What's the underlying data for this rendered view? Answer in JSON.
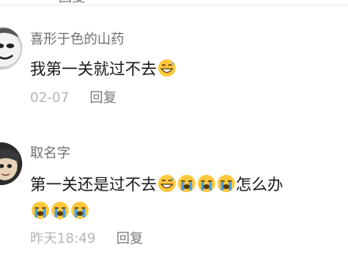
{
  "top": {
    "reply_label": "回复"
  },
  "comments": [
    {
      "username": "喜形于色的山药",
      "text": "我第一关就过不去",
      "emojis": [
        "grinning-sweat-icon"
      ],
      "time": "02-07",
      "reply_label": "回复"
    },
    {
      "username": "取名字",
      "text": "第一关还是过不去",
      "emojis_inline": [
        "grinning-sweat-icon",
        "crying-icon",
        "crying-icon",
        "crying-icon"
      ],
      "text_after": "怎么办",
      "emojis_line2": [
        "crying-icon",
        "crying-icon",
        "crying-icon"
      ],
      "time": "昨天18:49",
      "reply_label": "回复"
    }
  ],
  "colors": {
    "username": "#6f6f6f",
    "text": "#1a1a1a",
    "time": "#b5b5b5",
    "reply": "#7a7a7a",
    "emoji_face": "#ffc83d",
    "tear": "#4aa3e8"
  }
}
